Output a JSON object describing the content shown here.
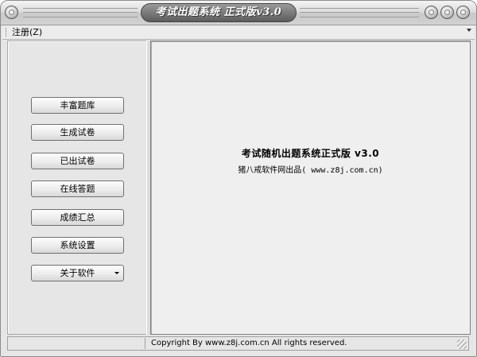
{
  "window": {
    "title": "考试出题系统 正式版v3.0"
  },
  "menubar": {
    "items": [
      {
        "label": "注册(Z)"
      }
    ]
  },
  "sidebar": {
    "buttons": [
      {
        "label": "丰富题库"
      },
      {
        "label": "生成试卷"
      },
      {
        "label": "已出试卷"
      },
      {
        "label": "在线答题"
      },
      {
        "label": "成绩汇总"
      },
      {
        "label": "系统设置"
      },
      {
        "label": "关于软件"
      }
    ]
  },
  "main": {
    "title": "考试随机出题系统正式版 v3.0",
    "subtitle": "猪八戒软件网出品( www.z8j.com.cn)"
  },
  "statusbar": {
    "text": "Copyright  By  www.z8j.com.cn All rights reserved."
  }
}
